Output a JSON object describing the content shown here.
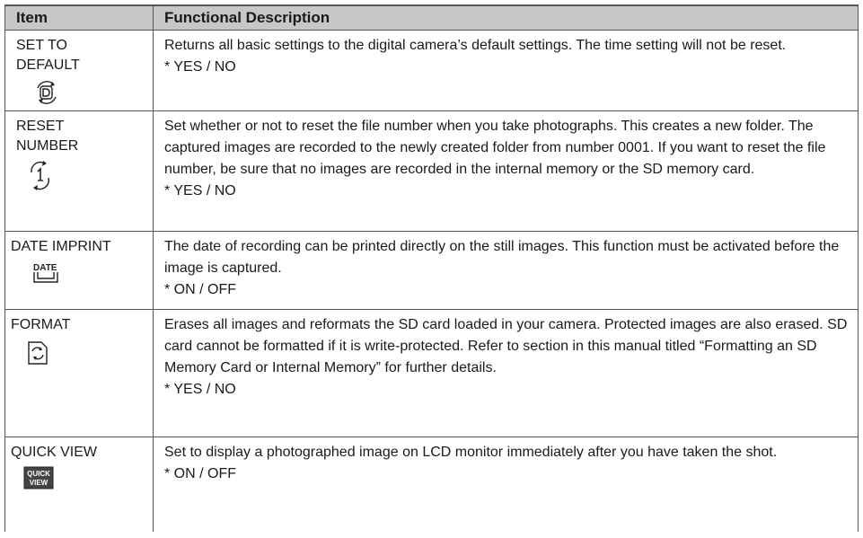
{
  "table": {
    "headers": {
      "item": "Item",
      "description": "Functional Description"
    },
    "rows": [
      {
        "item": "SET TO\nDEFAULT",
        "icon": "reset-defaults-icon",
        "description": "Returns all basic settings to the digital camera’s default settings. The time setting will not be reset.",
        "options": "* YES / NO"
      },
      {
        "item": "RESET\nNUMBER",
        "icon": "reset-number-icon",
        "description": "Set whether or not to reset the file number when you take photographs. This creates a new folder. The captured images are recorded to the newly created folder from number 0001. If you want to reset the file number, be sure that no images are recorded in the internal memory or the SD memory card.",
        "options": "* YES / NO"
      },
      {
        "item": "DATE IMPRINT",
        "icon": "date-imprint-icon",
        "description": "The date of recording can be printed directly on the still images. This function must be activated before the image is captured.",
        "options": "* ON / OFF"
      },
      {
        "item": "FORMAT",
        "icon": "format-card-icon",
        "description": "Erases all images and reformats the SD card loaded in your camera. Protected images are also erased. SD card cannot be formatted if it is write-protected. Refer to section in this manual titled “Formatting an SD Memory Card or Internal Memory” for further details.",
        "options": "* YES / NO"
      },
      {
        "item": "QUICK VIEW",
        "icon": "quick-view-icon",
        "description": "Set to display a photographed image on LCD monitor immediately after you have taken the shot.",
        "options": "* ON / OFF"
      }
    ],
    "icon_labels": {
      "date": "DATE",
      "quick": "QUICK",
      "view": "VIEW"
    }
  }
}
